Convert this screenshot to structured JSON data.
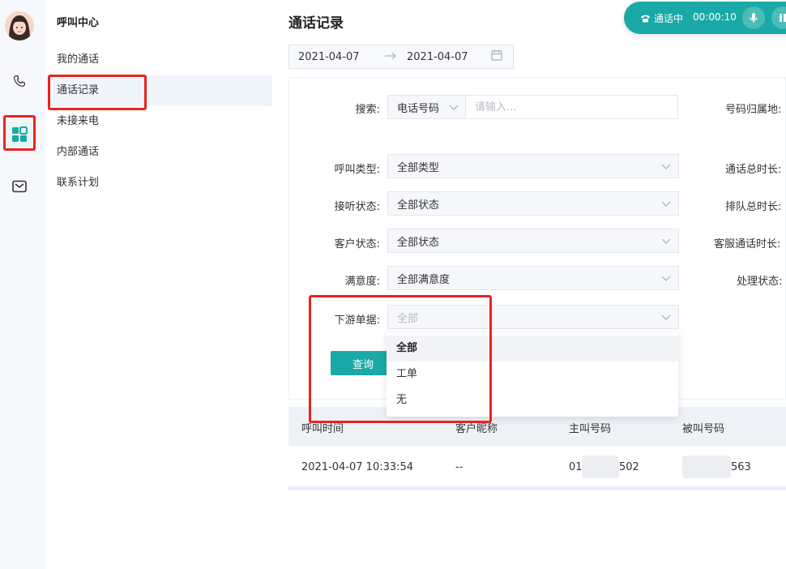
{
  "subnav": {
    "title": "呼叫中心",
    "items": [
      {
        "label": "我的通话"
      },
      {
        "label": "通话记录"
      },
      {
        "label": "未接来电"
      },
      {
        "label": "内部通话"
      },
      {
        "label": "联系计划"
      }
    ]
  },
  "main": {
    "title": "通话记录",
    "date_start": "2021-04-07",
    "date_end": "2021-04-07"
  },
  "filters": {
    "search_label": "搜索:",
    "search_type": "电话号码",
    "search_placeholder": "请输入...",
    "region_label": "号码归属地:",
    "call_type_label": "呼叫类型:",
    "call_type_value": "全部类型",
    "total_duration_label": "通话总时长:",
    "answer_status_label": "接听状态:",
    "answer_status_value": "全部状态",
    "queue_duration_label": "排队总时长:",
    "customer_status_label": "客户状态:",
    "customer_status_value": "全部状态",
    "agent_duration_label": "客服通话时长:",
    "satisfaction_label": "满意度:",
    "satisfaction_value": "全部满意度",
    "process_status_label": "处理状态:",
    "downstream_label": "下游单据:",
    "downstream_value": "全部",
    "downstream_options": [
      "全部",
      "工单",
      "无"
    ],
    "query_button": "查询"
  },
  "table": {
    "headers": [
      "呼叫时间",
      "客户昵称",
      "主叫号码",
      "被叫号码"
    ],
    "rows": [
      {
        "time": "2021-04-07 10:33:54",
        "nickname": "--",
        "caller": "01",
        "caller_tail": "502",
        "callee_tail": "563"
      }
    ]
  },
  "call": {
    "status": "通话中",
    "timer": "00:00:10"
  },
  "colors": {
    "accent": "#1aa9a6",
    "annotation": "#e8231f"
  }
}
